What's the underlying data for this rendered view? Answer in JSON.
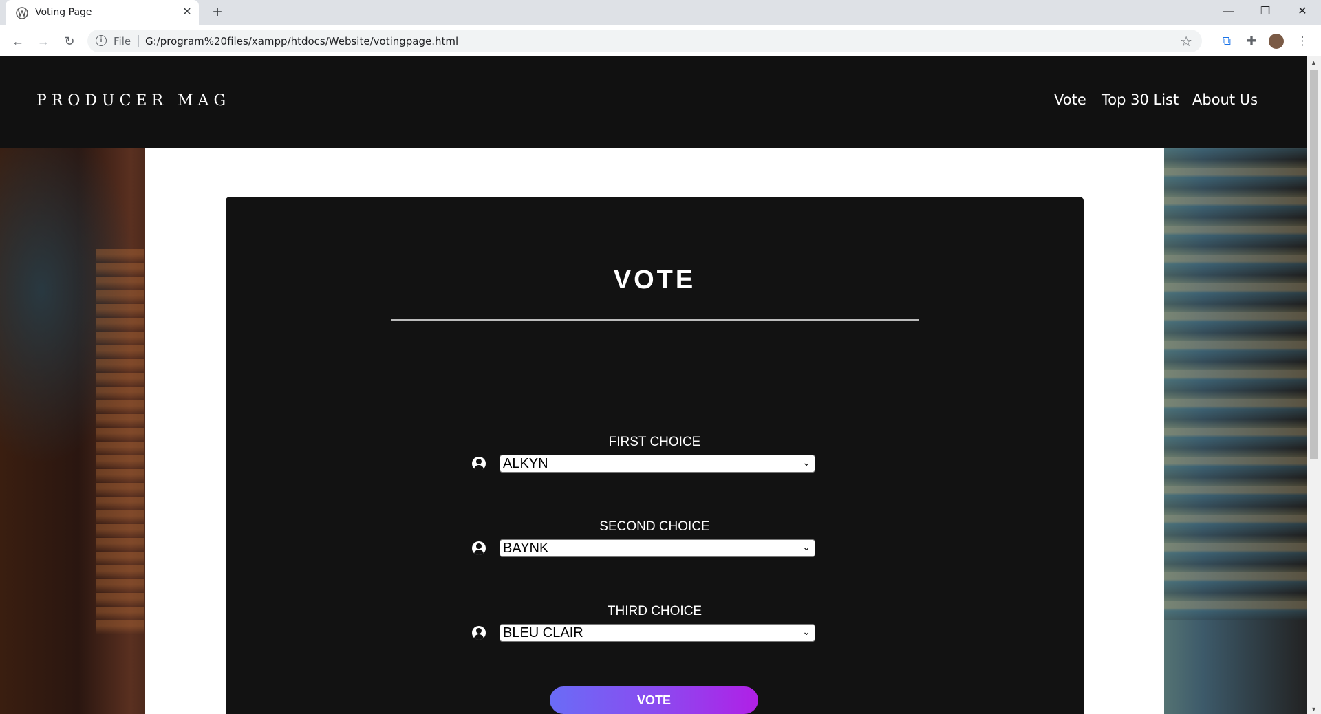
{
  "browser": {
    "tab_title": "Voting Page",
    "file_label": "File",
    "url": "G:/program%20files/xampp/htdocs/Website/votingpage.html"
  },
  "site": {
    "brand": "PRODUCER MAG",
    "nav": [
      "Vote",
      "Top 30 List",
      "About Us"
    ]
  },
  "vote": {
    "title": "VOTE",
    "choices": [
      {
        "label": "FIRST CHOICE",
        "selected": "ALKYN"
      },
      {
        "label": "SECOND CHOICE",
        "selected": "BAYNK"
      },
      {
        "label": "THIRD CHOICE",
        "selected": "BLEU CLAIR"
      }
    ],
    "button": "VOTE"
  },
  "colors": {
    "header_bg": "#111111",
    "card_bg": "#121212",
    "button_gradient_start": "#6a6cf6",
    "button_gradient_end": "#b020e6"
  }
}
